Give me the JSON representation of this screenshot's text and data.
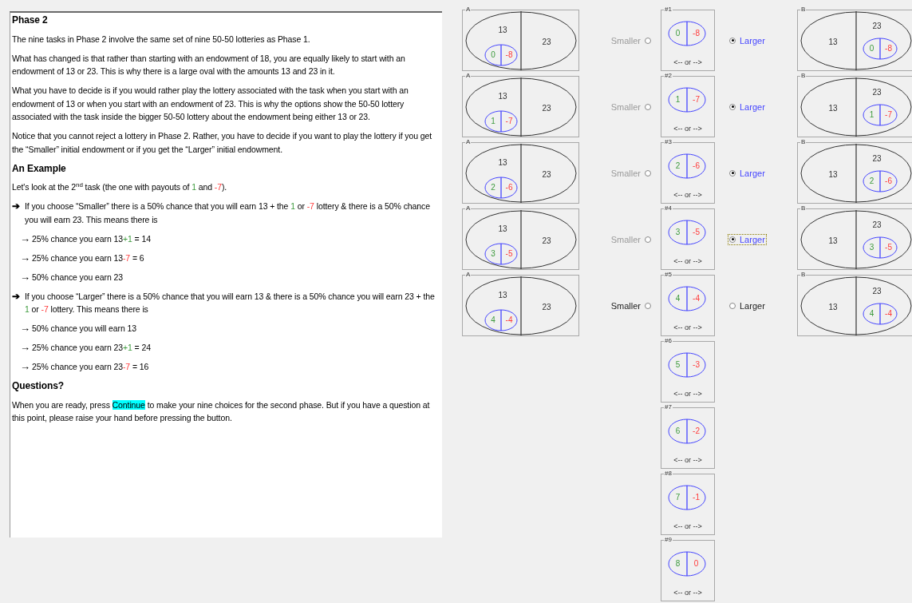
{
  "document": {
    "title": "Phase 2",
    "blocks": [
      {
        "kind": "para",
        "segments": [
          {
            "text": "The nine tasks in Phase 2 involve the same set of nine 50-50 lotteries as Phase 1."
          }
        ]
      },
      {
        "kind": "para",
        "segments": [
          {
            "text": "What has changed is that rather than starting with an endowment of 18, you are equally likely to start with an endowment of 13 or 23.  This is why there is a large oval with the amounts 13 and 23 in it."
          }
        ]
      },
      {
        "kind": "para",
        "segments": [
          {
            "text": "What you have to decide is if you would rather play the lottery associated with the task when you start with an endowment of 13 or when you start with an endowment of 23.  This is why the options show the 50-50 lottery associated with the task inside the bigger 50-50 lottery about the endowment being either 13 or 23."
          }
        ]
      },
      {
        "kind": "para",
        "segments": [
          {
            "text": "Notice that you cannot reject a lottery in Phase 2.  Rather, you have to decide if you want to play the lottery if you get the “Smaller” initial endowment or if you get the “Larger” initial endowment."
          }
        ]
      },
      {
        "kind": "heading",
        "segments": [
          {
            "text": "An Example"
          }
        ]
      },
      {
        "kind": "para",
        "segments": [
          {
            "text": "Let's look at the 2"
          },
          {
            "text": "nd",
            "kind": "sup"
          },
          {
            "text": " task (the one with payouts of "
          },
          {
            "text": "1",
            "kind": "gain"
          },
          {
            "text": " and "
          },
          {
            "text": "-7",
            "kind": "loss"
          },
          {
            "text": ")."
          }
        ]
      },
      {
        "kind": "bullet",
        "marker": "➔",
        "segments": [
          {
            "text": "If you choose “Smaller” there is a 50% chance that you will earn 13 + the "
          },
          {
            "text": "1",
            "kind": "gain"
          },
          {
            "text": " or "
          },
          {
            "text": "-7",
            "kind": "loss"
          },
          {
            "text": " lottery & there is a 50% chance you will earn 23. This means there is"
          }
        ]
      },
      {
        "kind": "subbullet",
        "marker": "→",
        "segments": [
          {
            "text": "25% chance you earn 13"
          },
          {
            "text": "+1",
            "kind": "gain"
          },
          {
            "text": " = 14"
          }
        ]
      },
      {
        "kind": "subbullet",
        "marker": "→",
        "segments": [
          {
            "text": "25% chance you earn 13"
          },
          {
            "text": "-7",
            "kind": "loss"
          },
          {
            "text": " = 6"
          }
        ]
      },
      {
        "kind": "subbullet",
        "marker": "→",
        "segments": [
          {
            "text": "50% chance you earn 23"
          }
        ]
      },
      {
        "kind": "bullet",
        "marker": "➔",
        "segments": [
          {
            "text": "If you choose “Larger” there is a 50% chance that you will earn 13 & there is a 50% chance you will earn 23 + the "
          },
          {
            "text": "1",
            "kind": "gain"
          },
          {
            "text": " or "
          },
          {
            "text": "-7",
            "kind": "loss"
          },
          {
            "text": " lottery.  This means there is"
          }
        ]
      },
      {
        "kind": "subbullet",
        "marker": "→",
        "segments": [
          {
            "text": "50% chance you will earn 13"
          }
        ]
      },
      {
        "kind": "subbullet",
        "marker": "→",
        "segments": [
          {
            "text": "25% chance you earn 23"
          },
          {
            "text": "+1",
            "kind": "gain"
          },
          {
            "text": " = 24"
          }
        ]
      },
      {
        "kind": "subbullet",
        "marker": "→",
        "segments": [
          {
            "text": "25% chance you earn 23"
          },
          {
            "text": "-7",
            "kind": "loss"
          },
          {
            "text": " = 16"
          }
        ]
      },
      {
        "kind": "heading",
        "segments": [
          {
            "text": "Questions?"
          }
        ]
      },
      {
        "kind": "para",
        "segments": [
          {
            "text": "When you are ready, press "
          },
          {
            "text": "Continue",
            "kind": "highlight"
          },
          {
            "text": " to make your nine choices for the second phase.  But if you have a question at this point, please raise your hand before pressing the button."
          }
        ]
      }
    ]
  },
  "tasks": [
    {
      "number": "#1",
      "gain": "0",
      "loss": "-8",
      "or": "<-- or -->",
      "option_a": {
        "label": "A",
        "smaller": "13",
        "larger": "23",
        "gain": "0",
        "loss": "-8"
      },
      "smaller": {
        "label": "Smaller",
        "selected": false,
        "focused": false
      },
      "larger": {
        "label": "Larger",
        "selected": true,
        "focused": false
      },
      "option_b": {
        "label": "B",
        "smaller": "13",
        "larger": "23",
        "gain": "0",
        "loss": "-8"
      }
    },
    {
      "number": "#2",
      "gain": "1",
      "loss": "-7",
      "or": "<-- or -->",
      "option_a": {
        "label": "A",
        "smaller": "13",
        "larger": "23",
        "gain": "1",
        "loss": "-7"
      },
      "smaller": {
        "label": "Smaller",
        "selected": false,
        "focused": false
      },
      "larger": {
        "label": "Larger",
        "selected": true,
        "focused": false
      },
      "option_b": {
        "label": "B",
        "smaller": "13",
        "larger": "23",
        "gain": "1",
        "loss": "-7"
      }
    },
    {
      "number": "#3",
      "gain": "2",
      "loss": "-6",
      "or": "<-- or -->",
      "option_a": {
        "label": "A",
        "smaller": "13",
        "larger": "23",
        "gain": "2",
        "loss": "-6"
      },
      "smaller": {
        "label": "Smaller",
        "selected": false,
        "focused": false
      },
      "larger": {
        "label": "Larger",
        "selected": true,
        "focused": false
      },
      "option_b": {
        "label": "B",
        "smaller": "13",
        "larger": "23",
        "gain": "2",
        "loss": "-6"
      }
    },
    {
      "number": "#4",
      "gain": "3",
      "loss": "-5",
      "or": "<-- or -->",
      "option_a": {
        "label": "A",
        "smaller": "13",
        "larger": "23",
        "gain": "3",
        "loss": "-5"
      },
      "smaller": {
        "label": "Smaller",
        "selected": false,
        "focused": false
      },
      "larger": {
        "label": "Larger",
        "selected": true,
        "focused": true
      },
      "option_b": {
        "label": "B",
        "smaller": "13",
        "larger": "23",
        "gain": "3",
        "loss": "-5"
      }
    },
    {
      "number": "#5",
      "gain": "4",
      "loss": "-4",
      "or": "<-- or -->",
      "option_a": {
        "label": "A",
        "smaller": "13",
        "larger": "23",
        "gain": "4",
        "loss": "-4"
      },
      "smaller": {
        "label": "Smaller",
        "selected": false,
        "focused": false
      },
      "larger": {
        "label": "Larger",
        "selected": false,
        "focused": false
      },
      "option_b": {
        "label": "B",
        "smaller": "13",
        "larger": "23",
        "gain": "4",
        "loss": "-4"
      }
    },
    {
      "number": "#6",
      "gain": "5",
      "loss": "-3",
      "or": "<-- or -->"
    },
    {
      "number": "#7",
      "gain": "6",
      "loss": "-2",
      "or": "<-- or -->"
    },
    {
      "number": "#8",
      "gain": "7",
      "loss": "-1",
      "or": "<-- or -->"
    },
    {
      "number": "#9",
      "gain": "8",
      "loss": "0",
      "or": "<-- or -->"
    }
  ]
}
